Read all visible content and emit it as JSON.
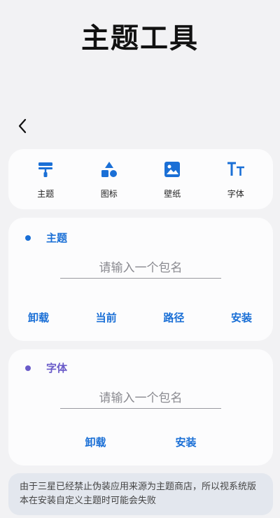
{
  "header": {
    "title": "主题工具"
  },
  "tabs": [
    {
      "label": "主题",
      "icon": "paint-roller-icon"
    },
    {
      "label": "图标",
      "icon": "shapes-icon"
    },
    {
      "label": "壁纸",
      "icon": "image-icon"
    },
    {
      "label": "字体",
      "icon": "font-icon"
    }
  ],
  "theme_section": {
    "title": "主题",
    "placeholder": "请输入一个包名",
    "actions": [
      "卸载",
      "当前",
      "路径",
      "安装"
    ],
    "color": "#1a6fd6"
  },
  "font_section": {
    "title": "字体",
    "placeholder": "请输入一个包名",
    "actions": [
      "卸载",
      "安装"
    ],
    "color": "#6a5bc9"
  },
  "note": {
    "text": "由于三星已经禁止伪装应用来源为主题商店，所以视系统版本在安装自定义主题时可能会失败"
  }
}
